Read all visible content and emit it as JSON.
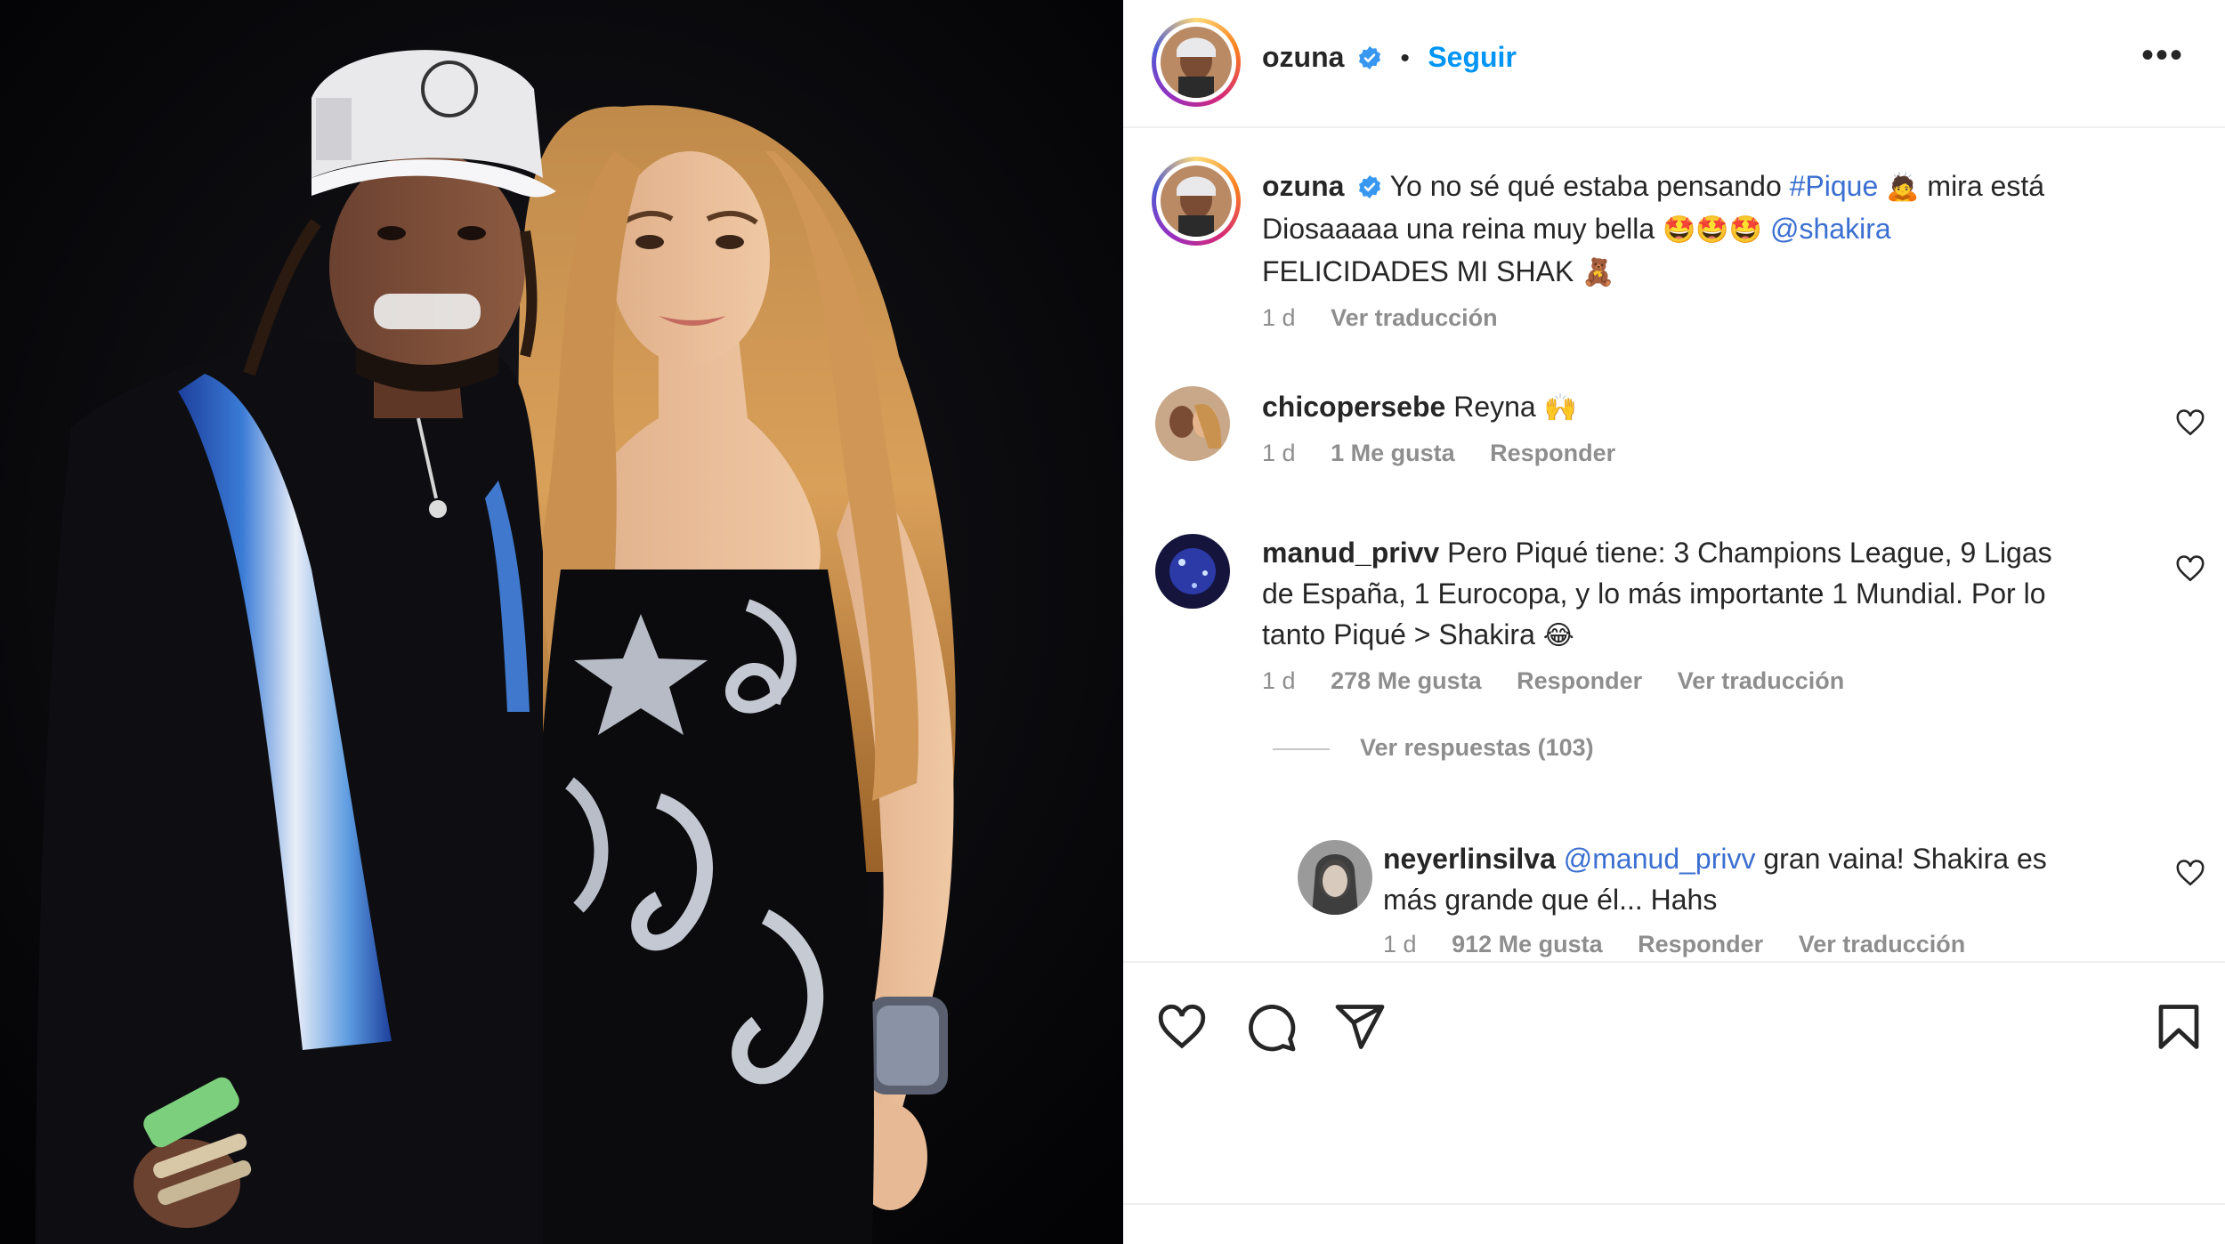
{
  "post": {
    "author": "ozuna",
    "follow_label": "Seguir",
    "dot": "•",
    "more": "•••",
    "caption": {
      "author": "ozuna",
      "part1": "Yo no sé qué estaba pensando",
      "hashtag": "#Pique",
      "emoji1": "🙇",
      "part2": "mira está",
      "part3": "Diosaaaaa una reina muy bella",
      "emoji2": "🤩🤩🤩",
      "mention": "@shakira",
      "part4": "FELICIDADES MI SHAK",
      "emoji3": "🧸",
      "time": "1 d",
      "translate": "Ver traducción"
    }
  },
  "comments": [
    {
      "user": "chicopersebe",
      "text": "Reyna",
      "emoji": "🙌",
      "time": "1 d",
      "likes": "1 Me gusta",
      "reply": "Responder"
    },
    {
      "user": "manud_privv",
      "text_line1": "Pero Piqué tiene: 3 Champions League, 9 Ligas",
      "text_line2": "de España, 1 Eurocopa, y lo más importante 1 Mundial. Por lo",
      "text_line3": "tanto Piqué > Shakira",
      "emoji": "😂",
      "time": "1 d",
      "likes": "278 Me gusta",
      "reply": "Responder",
      "translate": "Ver traducción",
      "view_replies": "Ver respuestas (103)"
    },
    {
      "user": "neyerlinsilva",
      "mention": "@manud_privv",
      "text_line1": "gran vaina! Shakira es",
      "text_line2": "más grande que él... Hahs",
      "time": "1 d",
      "likes": "912 Me gusta",
      "reply": "Responder",
      "translate": "Ver traducción"
    }
  ],
  "icons": [
    "verified-icon",
    "more-icon",
    "heart-icon",
    "comment-icon",
    "share-icon",
    "bookmark-icon"
  ],
  "colors": {
    "link": "#0095f6",
    "mention": "#3b6fd1",
    "muted": "#8e8e8e",
    "text": "#262626"
  }
}
